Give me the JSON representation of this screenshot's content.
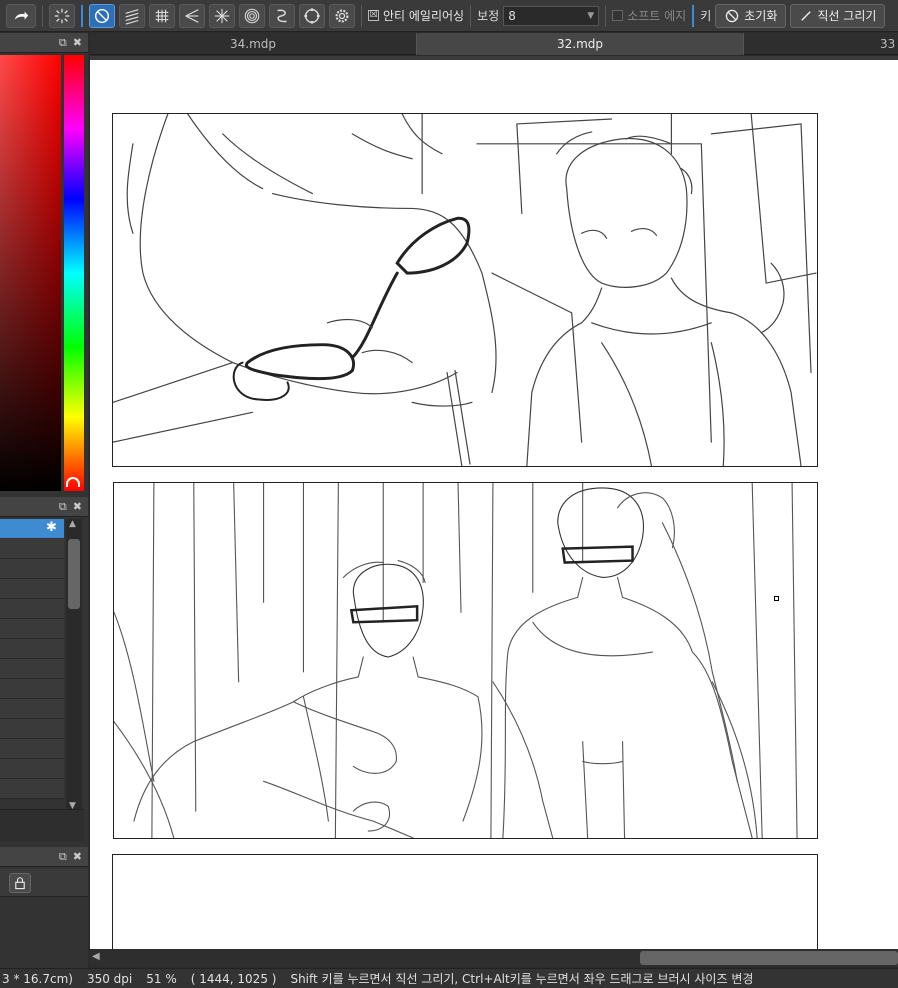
{
  "toolbar": {
    "icons": [
      "arrow-right-icon",
      "sparkle-spinner-icon",
      "no-entry-icon",
      "parallel-lines-icon",
      "grid-icon",
      "perspective-icon",
      "radial-burst-icon",
      "concentric-circles-icon",
      "curve-ruler-icon",
      "circle-ruler-icon",
      "gear-icon"
    ],
    "antialias_label": "안티 에일리어싱",
    "antialias_checked": "☒",
    "correction_label": "보정",
    "correction_value": "8",
    "soft_edge_label": "소프트 에지",
    "key_label": "키",
    "reset_label": "초기화",
    "line_draw_label": "직선 그리기"
  },
  "tabs": [
    "34.mdp",
    "32.mdp",
    "33"
  ],
  "active_tab": "32.mdp",
  "status": {
    "size": "3 * 16.7cm)",
    "dpi": "350 dpi",
    "zoom": "51 %",
    "coords": "( 1444, 1025 )",
    "hint": "Shift 키를 누르면서 직선 그리기, Ctrl+Alt키를 누르면서 좌우 드래그로 브러시 사이즈 변경"
  },
  "colors": {
    "accent": "#3e8bd1",
    "toolbar_bg": "#3a3a3a",
    "panel_bg": "#333333"
  }
}
